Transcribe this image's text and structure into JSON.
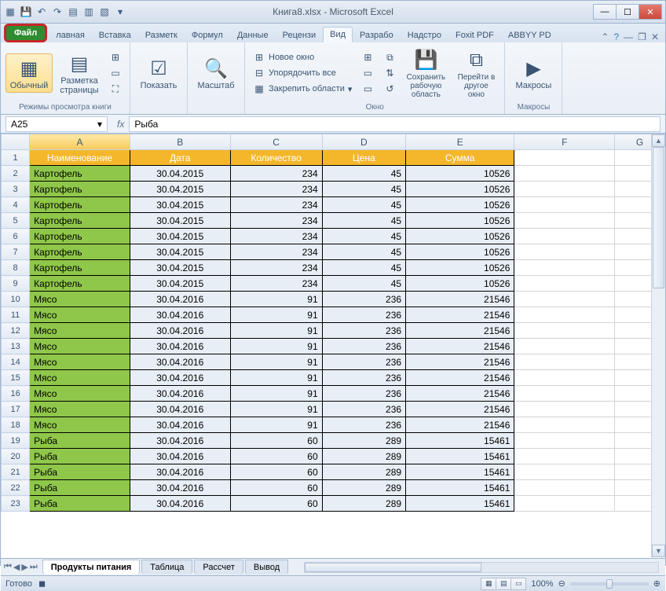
{
  "title": "Книга8.xlsx - Microsoft Excel",
  "tabs": {
    "file": "Файл",
    "home": "лавная",
    "insert": "Вставка",
    "layout": "Разметк",
    "formulas": "Формул",
    "data": "Данные",
    "review": "Рецензи",
    "view": "Вид",
    "developer": "Разрабо",
    "addins": "Надстро",
    "foxit": "Foxit PDF",
    "abbyy": "ABBYY PD"
  },
  "ribbon": {
    "group1": "Режимы просмотра книги",
    "normal": "Обычный",
    "pagelayout": "Разметка страницы",
    "show": "Показать",
    "zoom": "Масштаб",
    "newwin": "Новое окно",
    "arrange": "Упорядочить все",
    "freeze": "Закрепить области",
    "window": "Окно",
    "savews": "Сохранить рабочую область",
    "switchwin": "Перейти в другое окно",
    "macros": "Макросы",
    "macros_group": "Макросы"
  },
  "namebox": "A25",
  "formula": "Рыба",
  "cols": [
    "",
    "A",
    "B",
    "C",
    "D",
    "E",
    "F",
    "G"
  ],
  "headers": [
    "Наименование",
    "Дата",
    "Количество",
    "Цена",
    "Сумма"
  ],
  "rows": [
    {
      "n": "Картофель",
      "d": "30.04.2015",
      "q": "234",
      "p": "45",
      "s": "10526"
    },
    {
      "n": "Картофель",
      "d": "30.04.2015",
      "q": "234",
      "p": "45",
      "s": "10526"
    },
    {
      "n": "Картофель",
      "d": "30.04.2015",
      "q": "234",
      "p": "45",
      "s": "10526"
    },
    {
      "n": "Картофель",
      "d": "30.04.2015",
      "q": "234",
      "p": "45",
      "s": "10526"
    },
    {
      "n": "Картофель",
      "d": "30.04.2015",
      "q": "234",
      "p": "45",
      "s": "10526"
    },
    {
      "n": "Картофель",
      "d": "30.04.2015",
      "q": "234",
      "p": "45",
      "s": "10526"
    },
    {
      "n": "Картофель",
      "d": "30.04.2015",
      "q": "234",
      "p": "45",
      "s": "10526"
    },
    {
      "n": "Картофель",
      "d": "30.04.2015",
      "q": "234",
      "p": "45",
      "s": "10526"
    },
    {
      "n": "Мясо",
      "d": "30.04.2016",
      "q": "91",
      "p": "236",
      "s": "21546"
    },
    {
      "n": "Мясо",
      "d": "30.04.2016",
      "q": "91",
      "p": "236",
      "s": "21546"
    },
    {
      "n": "Мясо",
      "d": "30.04.2016",
      "q": "91",
      "p": "236",
      "s": "21546"
    },
    {
      "n": "Мясо",
      "d": "30.04.2016",
      "q": "91",
      "p": "236",
      "s": "21546"
    },
    {
      "n": "Мясо",
      "d": "30.04.2016",
      "q": "91",
      "p": "236",
      "s": "21546"
    },
    {
      "n": "Мясо",
      "d": "30.04.2016",
      "q": "91",
      "p": "236",
      "s": "21546"
    },
    {
      "n": "Мясо",
      "d": "30.04.2016",
      "q": "91",
      "p": "236",
      "s": "21546"
    },
    {
      "n": "Мясо",
      "d": "30.04.2016",
      "q": "91",
      "p": "236",
      "s": "21546"
    },
    {
      "n": "Мясо",
      "d": "30.04.2016",
      "q": "91",
      "p": "236",
      "s": "21546"
    },
    {
      "n": "Рыба",
      "d": "30.04.2016",
      "q": "60",
      "p": "289",
      "s": "15461"
    },
    {
      "n": "Рыба",
      "d": "30.04.2016",
      "q": "60",
      "p": "289",
      "s": "15461"
    },
    {
      "n": "Рыба",
      "d": "30.04.2016",
      "q": "60",
      "p": "289",
      "s": "15461"
    },
    {
      "n": "Рыба",
      "d": "30.04.2016",
      "q": "60",
      "p": "289",
      "s": "15461"
    },
    {
      "n": "Рыба",
      "d": "30.04.2016",
      "q": "60",
      "p": "289",
      "s": "15461"
    }
  ],
  "sheets": [
    "Продукты питания",
    "Таблица",
    "Рассчет",
    "Вывод"
  ],
  "status": "Готово",
  "zoom": "100%"
}
